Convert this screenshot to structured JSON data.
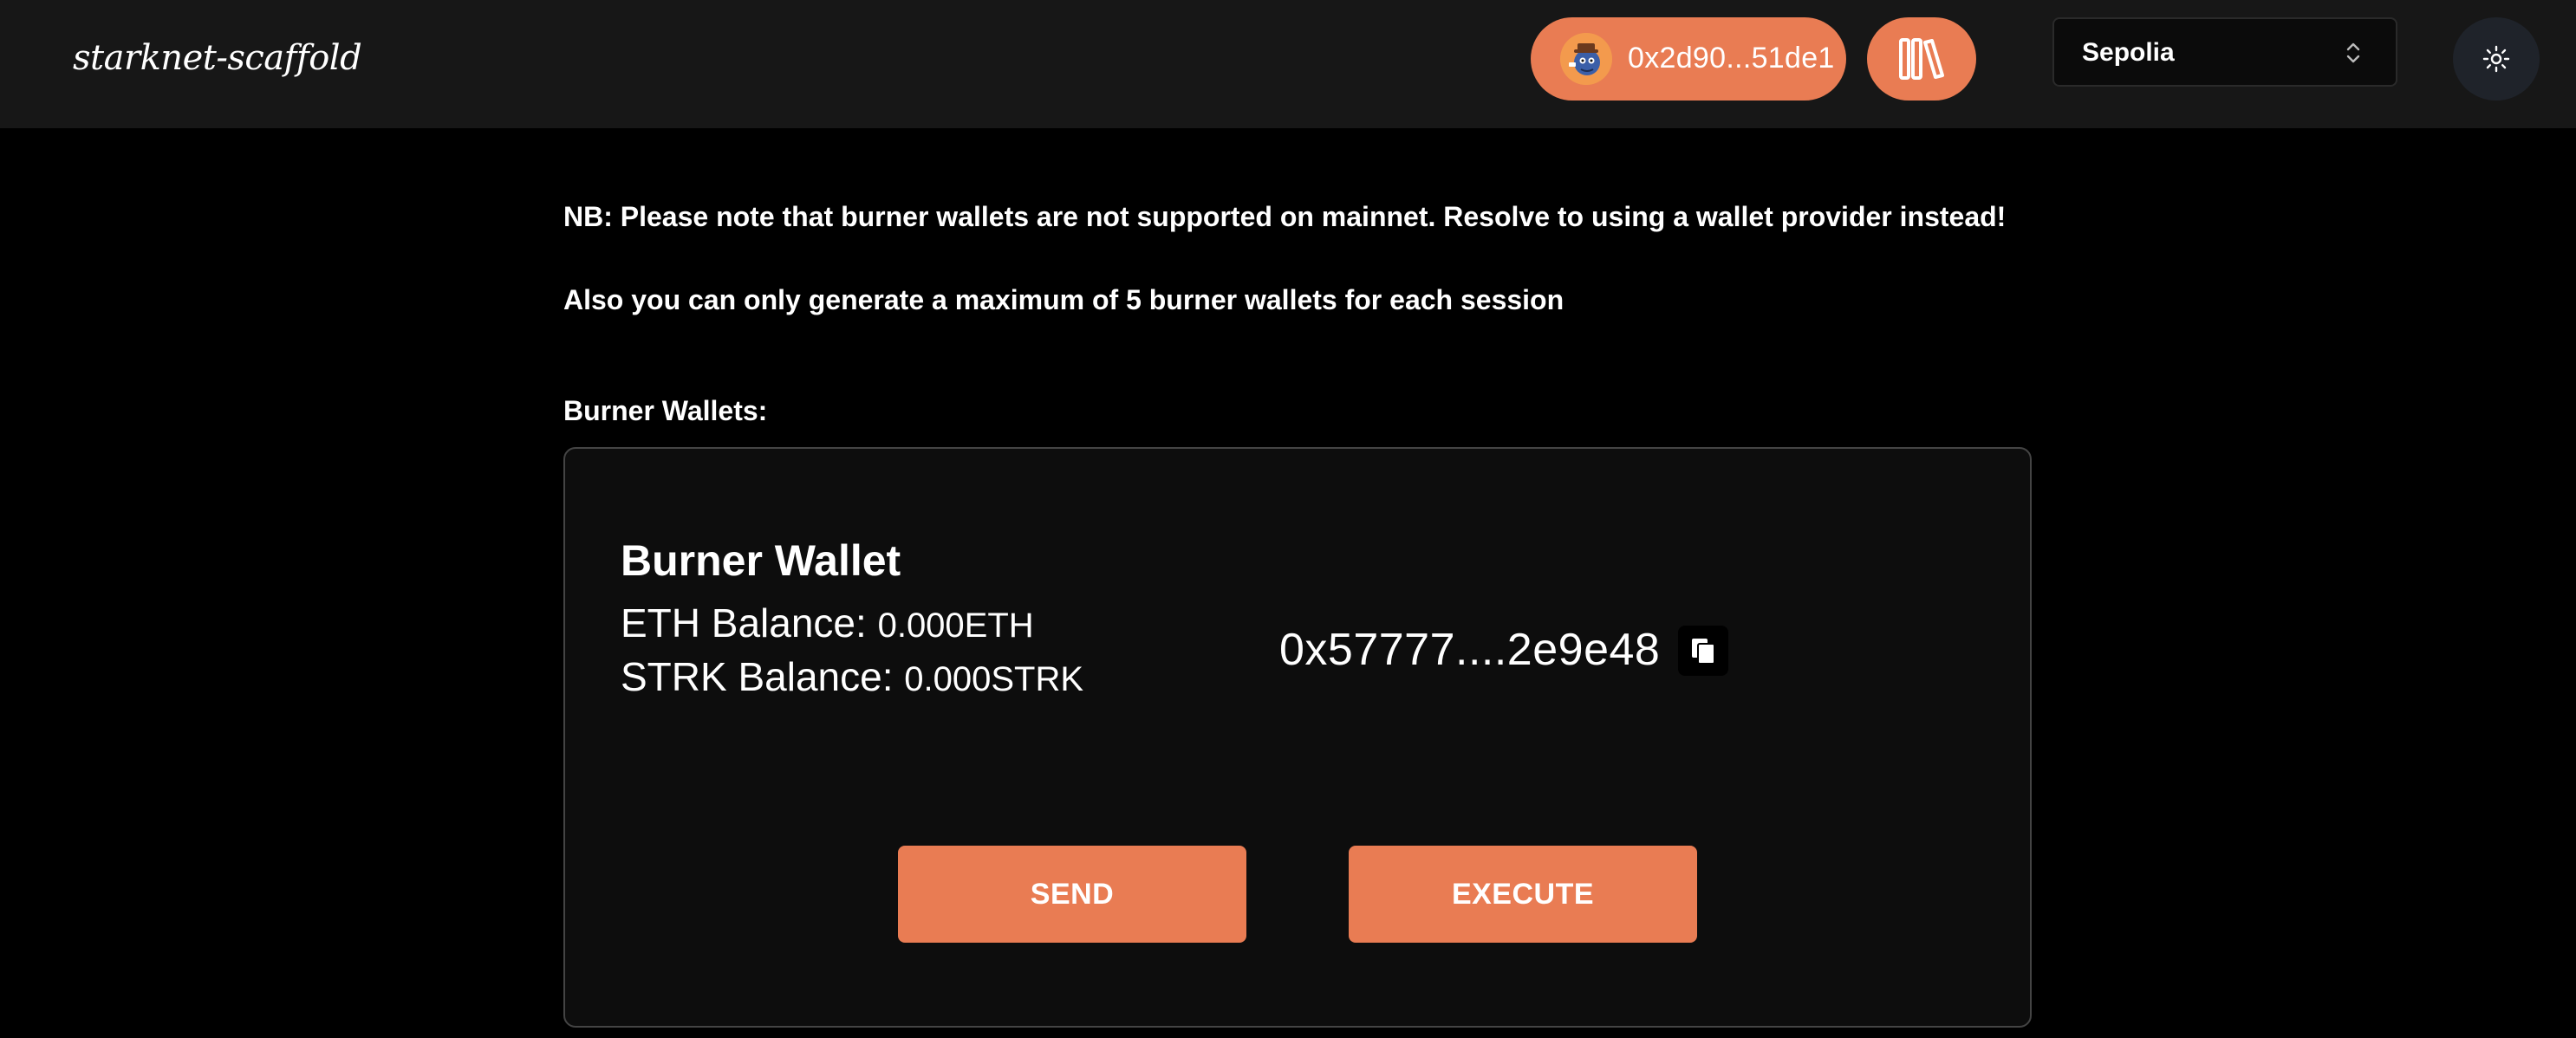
{
  "header": {
    "logo_text": "starknet-scaffold",
    "account_address": "0x2d90...51de1",
    "network": {
      "selected": "Sepolia"
    },
    "icons": {
      "avatar": "avatar-icon",
      "library": "book-icon",
      "network_chevron": "chevron-up-down-icon",
      "theme_toggle": "sun-icon"
    }
  },
  "notices": {
    "mainnet_warning": "NB: Please note that burner wallets are not supported on mainnet. Resolve to using a wallet provider instead!",
    "max_wallets": "Also you can only generate a maximum of 5 burner wallets for each session"
  },
  "burner_section": {
    "title": "Burner Wallets:",
    "wallet": {
      "title": "Burner Wallet",
      "eth_label": "ETH Balance: ",
      "eth_value": "0.000ETH",
      "strk_label": "STRK Balance: ",
      "strk_value": "0.000STRK",
      "address": "0x57777....2e9e48",
      "copy_icon": "copy-icon",
      "send_label": "SEND",
      "execute_label": "EXECUTE"
    }
  },
  "colors": {
    "accent": "#e97c53",
    "header_bg": "#171717",
    "page_bg": "#000000",
    "card_bg": "#0d0d0d",
    "card_border": "#444444"
  }
}
